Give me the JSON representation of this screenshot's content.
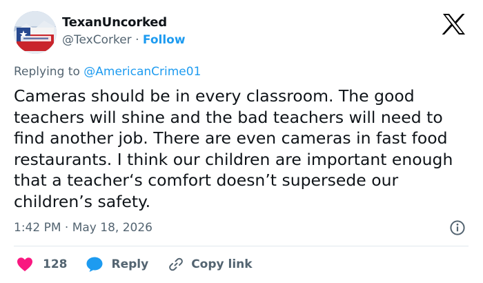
{
  "author": {
    "name": "TexanUncorked",
    "handle": "@TexCorker",
    "separator": "·",
    "follow_label": "Follow"
  },
  "reply_context": {
    "prefix": "Replying to",
    "mention": "@AmericanCrime01"
  },
  "tweet": {
    "text": "Cameras should be in every classroom. The good teachers will shine and the bad teachers will need to find another job. There are even cameras in fast food restaurants. I think our children are important enough that a teacher‘s comfort doesn’t supersede our children’s safety.",
    "timestamp": "1:42 PM · May 18, 2026"
  },
  "actions": {
    "like_count": "128",
    "reply_label": "Reply",
    "copy_link_label": "Copy link"
  },
  "icons": {
    "brand": "x-logo-icon",
    "info": "info-icon",
    "like": "heart-icon",
    "reply": "speech-bubble-icon",
    "copy": "link-icon"
  },
  "colors": {
    "text": "#0f1419",
    "secondary": "#536471",
    "accent": "#1d9bf0",
    "like": "#f91880"
  }
}
